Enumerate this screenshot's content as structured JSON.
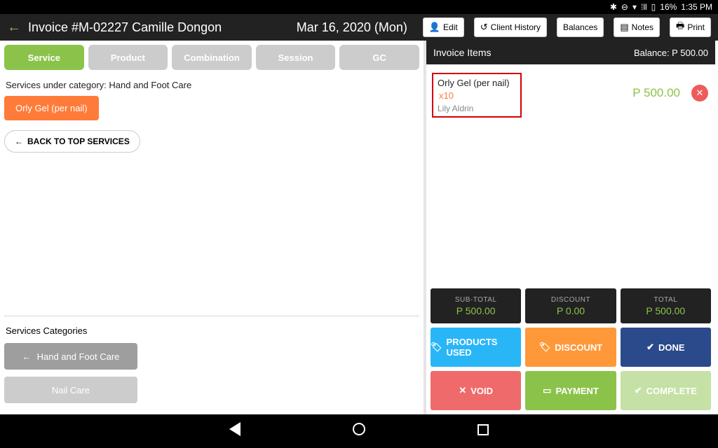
{
  "status": {
    "battery": "16%",
    "time": "1:35 PM"
  },
  "header": {
    "title": "Invoice #M-02227 Camille Dongon",
    "date": "Mar 16, 2020 (Mon)",
    "buttons": {
      "edit": "Edit",
      "client_history": "Client History",
      "balances": "Balances",
      "notes": "Notes",
      "print": "Print"
    }
  },
  "tabs": {
    "service": "Service",
    "product": "Product",
    "combination": "Combination",
    "session": "Session",
    "gc": "GC"
  },
  "services": {
    "under_label": "Services under category: Hand and Foot Care",
    "item": "Orly Gel (per nail)",
    "back": "BACK TO TOP SERVICES"
  },
  "categories": {
    "label": "Services Categories",
    "hand": "Hand and Foot Care",
    "nail": "Nail Care"
  },
  "invoice": {
    "header": "Invoice Items",
    "balance": "Balance: P 500.00",
    "item_name": "Orly Gel (per nail)",
    "item_qty": "x10",
    "item_staff": "Lily Aldrin",
    "item_price": "P 500.00"
  },
  "totals": {
    "subtotal_label": "SUB-TOTAL",
    "subtotal": "P 500.00",
    "discount_label": "DISCOUNT",
    "discount": "P 0.00",
    "total_label": "TOTAL",
    "total": "P 500.00"
  },
  "actions": {
    "products_used": "PRODUCTS USED",
    "discount": "DISCOUNT",
    "done": "DONE",
    "void": "VOID",
    "payment": "PAYMENT",
    "complete": "COMPLETE"
  }
}
